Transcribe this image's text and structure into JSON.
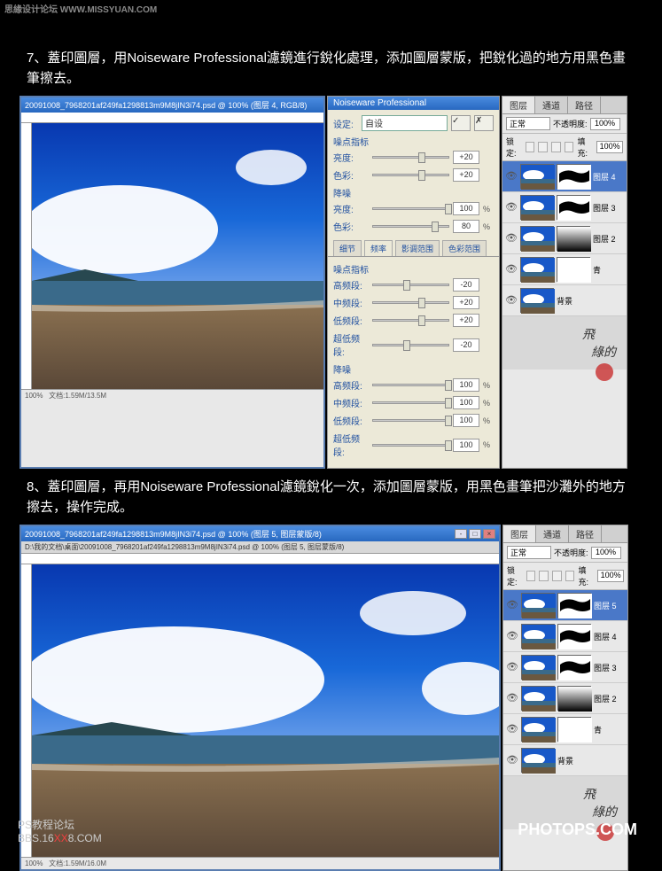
{
  "watermark_top": "思緣设计论坛 WWW.MISSYUAN.COM",
  "instruction7": "7、蓋印圖層，用Noiseware Professional濾鏡進行銳化處理，添加圖層蒙版，把銳化過的地方用黑色畫筆擦去。",
  "instruction8": "8、蓋印圖層，再用Noiseware Professional濾鏡銳化一次，添加圖層蒙版，用黑色畫筆把沙灘外的地方擦去，操作完成。",
  "ps1": {
    "title": "20091008_7968201af249fa1298813m9M8jIN3i74.psd @ 100% (图层 4, RGB/8)",
    "status_zoom": "100%",
    "status_doc": "文档:1.59M/13.5M"
  },
  "ps2": {
    "title": "20091008_7968201af249fa1298813m9M8jIN3i74.psd @ 100% (图层 5, 图层蒙版/8)",
    "tab": "D:\\我的文档\\桌面\\20091008_7968201af249fa1298813m9M8jIN3i74.psd @ 100% (图层 5, 图层蒙版/8)",
    "status_zoom": "100%",
    "status_doc": "文档:1.59M/16.0M"
  },
  "noiseware": {
    "title": "Noiseware Professional",
    "preset_label": "设定:",
    "preset_value": "自设",
    "group_noise": "噪点指标",
    "group_reduce": "降噪",
    "label_brightness": "亮度:",
    "label_color": "色彩:",
    "val_bright1": "+20",
    "val_color1": "+20",
    "val_bright2": "100",
    "val_color2": "80",
    "unit_pct": "%",
    "tabs": [
      "细节",
      "频率",
      "影调范围",
      "色彩范围"
    ],
    "active_tab": 1,
    "group_noise2": "噪点指标",
    "label_high": "高频段:",
    "label_mid": "中频段:",
    "label_low": "低频段:",
    "label_vlow": "超低频段:",
    "freq_high": "-20",
    "freq_mid": "+20",
    "freq_low": "+20",
    "freq_vlow": "-20",
    "group_reduce2": "降噪",
    "red_high": "100",
    "red_mid": "100",
    "red_low": "100",
    "red_vlow": "100"
  },
  "layers": {
    "tabs": [
      "图层",
      "通道",
      "路径"
    ],
    "blend": "正常",
    "opacity_label": "不透明度:",
    "opacity": "100%",
    "lock_label": "锁定:",
    "fill_label": "填充:",
    "fill": "100%",
    "set1": [
      {
        "name": "图层 4",
        "mask": "brush"
      },
      {
        "name": "图层 3",
        "mask": "brush"
      },
      {
        "name": "图层 2",
        "mask": "grad"
      },
      {
        "name": "青",
        "mask": "white"
      },
      {
        "name": "背景",
        "mask": null
      }
    ],
    "set2": [
      {
        "name": "图层 5",
        "mask": "brush"
      },
      {
        "name": "图层 4",
        "mask": "brush"
      },
      {
        "name": "图层 3",
        "mask": "brush"
      },
      {
        "name": "图层 2",
        "mask": "grad"
      },
      {
        "name": "青",
        "mask": "white"
      },
      {
        "name": "背景",
        "mask": null
      }
    ]
  },
  "bottom_wm1": "PS教程论坛",
  "bottom_wm2_a": "BBS.16",
  "bottom_wm2_b": "XX",
  "bottom_wm2_c": "8.COM",
  "bottom_wm_r": "PHOTOPS.COM"
}
